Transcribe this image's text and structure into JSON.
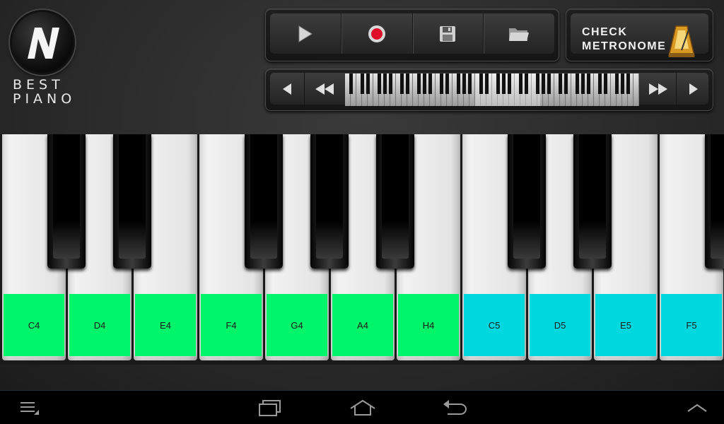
{
  "app": {
    "logo": {
      "line1": "BEST",
      "line2": "PIANO",
      "glyph": "N"
    },
    "metronome": {
      "line1": "CHECK",
      "line2": "METRONOME"
    }
  },
  "transport": {
    "buttons": [
      {
        "name": "play-icon"
      },
      {
        "name": "record-icon"
      },
      {
        "name": "save-icon"
      },
      {
        "name": "open-folder-icon"
      }
    ]
  },
  "navigator": {
    "buttons": [
      "step-left-icon",
      "fast-rewind-icon",
      "fast-forward-icon",
      "step-right-icon"
    ]
  },
  "colors": {
    "octave4": "#00f56a",
    "octave5": "#00d8e0",
    "record": "#e0102a"
  },
  "keys": {
    "white": [
      {
        "label": "C4",
        "octave": 4
      },
      {
        "label": "D4",
        "octave": 4
      },
      {
        "label": "E4",
        "octave": 4
      },
      {
        "label": "F4",
        "octave": 4
      },
      {
        "label": "G4",
        "octave": 4
      },
      {
        "label": "A4",
        "octave": 4
      },
      {
        "label": "H4",
        "octave": 4
      },
      {
        "label": "C5",
        "octave": 5
      },
      {
        "label": "D5",
        "octave": 5
      },
      {
        "label": "E5",
        "octave": 5
      },
      {
        "label": "F5",
        "octave": 5
      }
    ]
  },
  "system_bar": {
    "buttons": [
      "menu-icon",
      "recent-apps-icon",
      "home-icon",
      "back-icon",
      "chevron-up-icon"
    ]
  }
}
